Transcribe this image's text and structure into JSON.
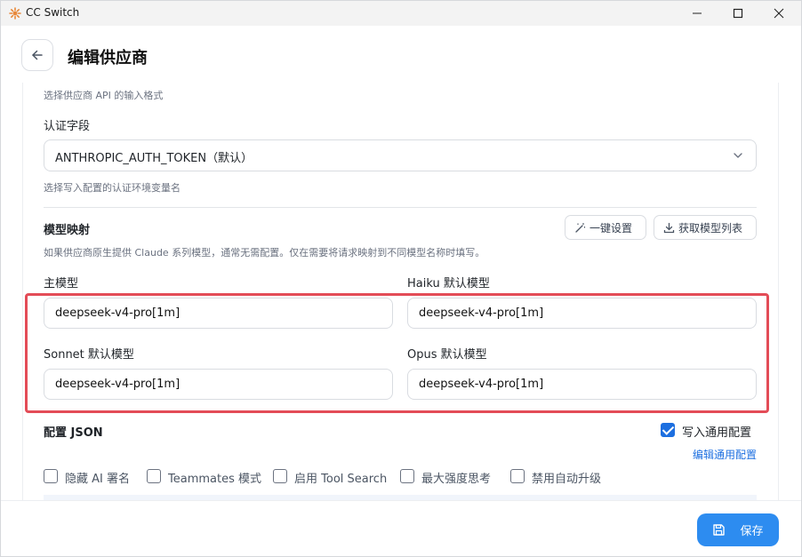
{
  "window": {
    "title": "CC Switch"
  },
  "header": {
    "title": "编辑供应商"
  },
  "api_format": {
    "hint": "选择供应商 API 的输入格式"
  },
  "auth_field": {
    "label": "认证字段",
    "selected": "ANTHROPIC_AUTH_TOKEN（默认）",
    "hint": "选择写入配置的认证环境变量名"
  },
  "model_mapping": {
    "title": "模型映射",
    "quick_setup_label": "一键设置",
    "fetch_models_label": "获取模型列表",
    "hint": "如果供应商原生提供 Claude 系列模型，通常无需配置。仅在需要将请求映射到不同模型名称时填写。",
    "main_label": "主模型",
    "main_value": "deepseek-v4-pro[1m]",
    "haiku_label": "Haiku 默认模型",
    "haiku_value": "deepseek-v4-pro[1m]",
    "sonnet_label": "Sonnet 默认模型",
    "sonnet_value": "deepseek-v4-pro[1m]",
    "opus_label": "Opus 默认模型",
    "opus_value": "deepseek-v4-pro[1m]"
  },
  "config_json": {
    "title": "配置 JSON",
    "write_common_label": "写入通用配置",
    "write_common_checked": true,
    "edit_common_link": "编辑通用配置",
    "options": [
      {
        "label": "隐藏 AI 署名",
        "checked": false
      },
      {
        "label": "Teammates 模式",
        "checked": false
      },
      {
        "label": "启用 Tool Search",
        "checked": false
      },
      {
        "label": "最大强度思考",
        "checked": false
      },
      {
        "label": "禁用自动升级",
        "checked": false
      }
    ]
  },
  "footer": {
    "save_label": "保存"
  },
  "colors": {
    "accent": "#2d8cf0",
    "highlight": "#e34c57"
  }
}
